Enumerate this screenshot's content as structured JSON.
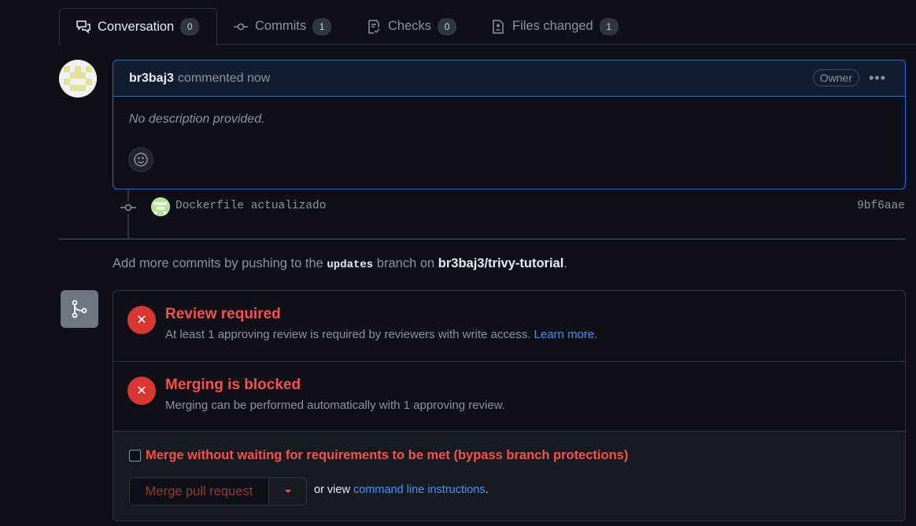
{
  "tabs": [
    {
      "label": "Conversation",
      "count": "0",
      "icon": "comment-discussion-icon"
    },
    {
      "label": "Commits",
      "count": "1",
      "icon": "git-commit-icon"
    },
    {
      "label": "Checks",
      "count": "0",
      "icon": "checklist-icon"
    },
    {
      "label": "Files changed",
      "count": "1",
      "icon": "file-diff-icon"
    }
  ],
  "comment": {
    "author": "br3baj3",
    "meta": "commented now",
    "badge": "Owner",
    "more_icon": "kebab-horizontal-icon",
    "body": "No description provided.",
    "reaction_icon": "smiley-icon"
  },
  "commit": {
    "message": "Dockerfile actualizado",
    "sha": "9bf6aae"
  },
  "push_hint": {
    "prefix": "Add more commits by pushing to the",
    "branch": "updates",
    "middle": "branch on",
    "repo": "br3baj3/trivy-tutorial",
    "suffix": "."
  },
  "merge": {
    "review": {
      "title": "Review required",
      "desc": "At least 1 approving review is required by reviewers with write access.",
      "link": "Learn more."
    },
    "blocked": {
      "title": "Merging is blocked",
      "desc": "Merging can be performed automatically with 1 approving review."
    },
    "bypass_label": "Merge without waiting for requirements to be met (bypass branch protections)",
    "merge_button": "Merge pull request",
    "or_view": "or view",
    "cli_link": "command line instructions",
    "cli_suffix": "."
  },
  "colors": {
    "background": "#0d1117",
    "accent_blue": "#1f6feb",
    "danger": "#f85149",
    "link": "#4493f8"
  }
}
